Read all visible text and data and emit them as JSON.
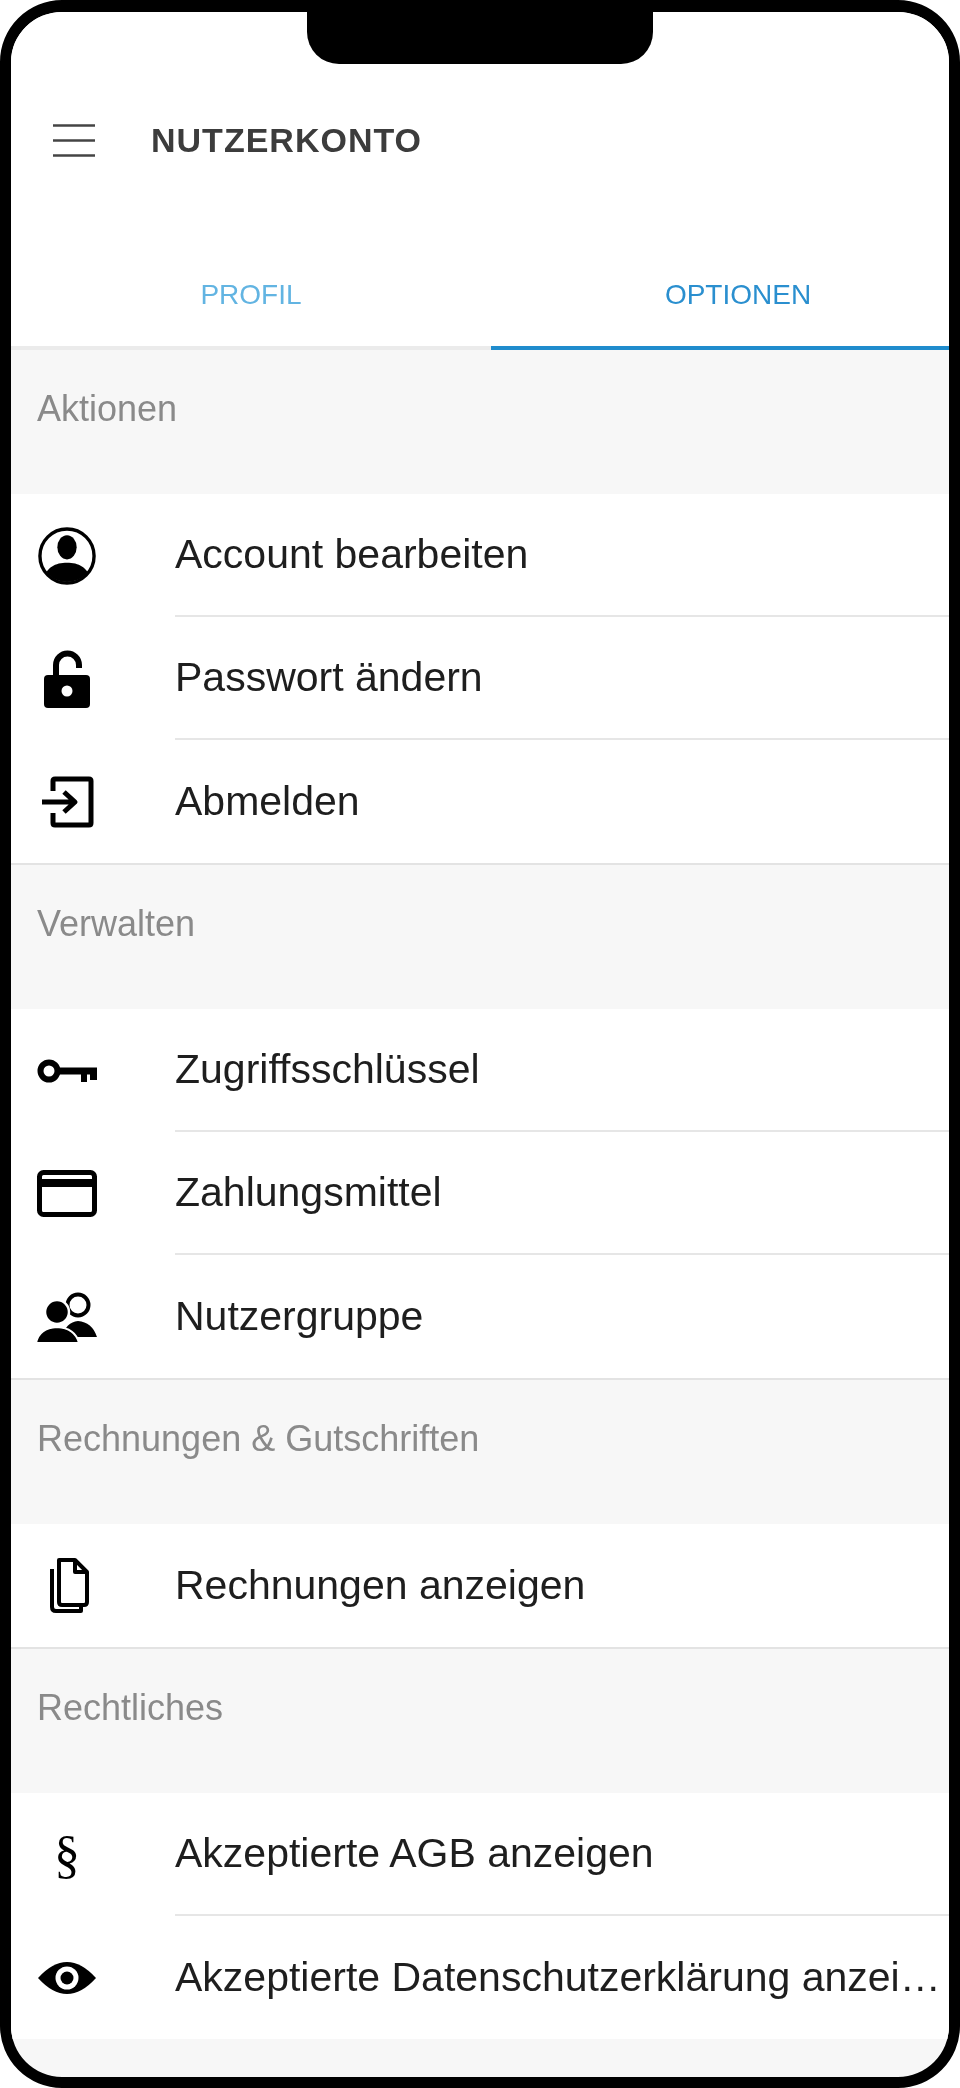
{
  "header": {
    "title": "NUTZERKONTO"
  },
  "tabs": [
    {
      "label": "PROFIL",
      "selected": false
    },
    {
      "label": "OPTIONEN",
      "selected": true
    }
  ],
  "sections": [
    {
      "title": "Aktionen",
      "items": [
        {
          "label": "Account bearbeiten"
        },
        {
          "label": "Passwort ändern"
        },
        {
          "label": "Abmelden"
        }
      ]
    },
    {
      "title": "Verwalten",
      "items": [
        {
          "label": "Zugriffsschlüssel"
        },
        {
          "label": "Zahlungsmittel"
        },
        {
          "label": "Nutzergruppe"
        }
      ]
    },
    {
      "title": "Rechnungen & Gutschriften",
      "items": [
        {
          "label": "Rechnungen anzeigen"
        }
      ]
    },
    {
      "title": "Rechtliches",
      "items": [
        {
          "label": "Akzeptierte AGB anzeigen",
          "icon_text": "§"
        },
        {
          "label": "Akzeptierte Datenschutzerklärung anzei…"
        }
      ]
    }
  ]
}
